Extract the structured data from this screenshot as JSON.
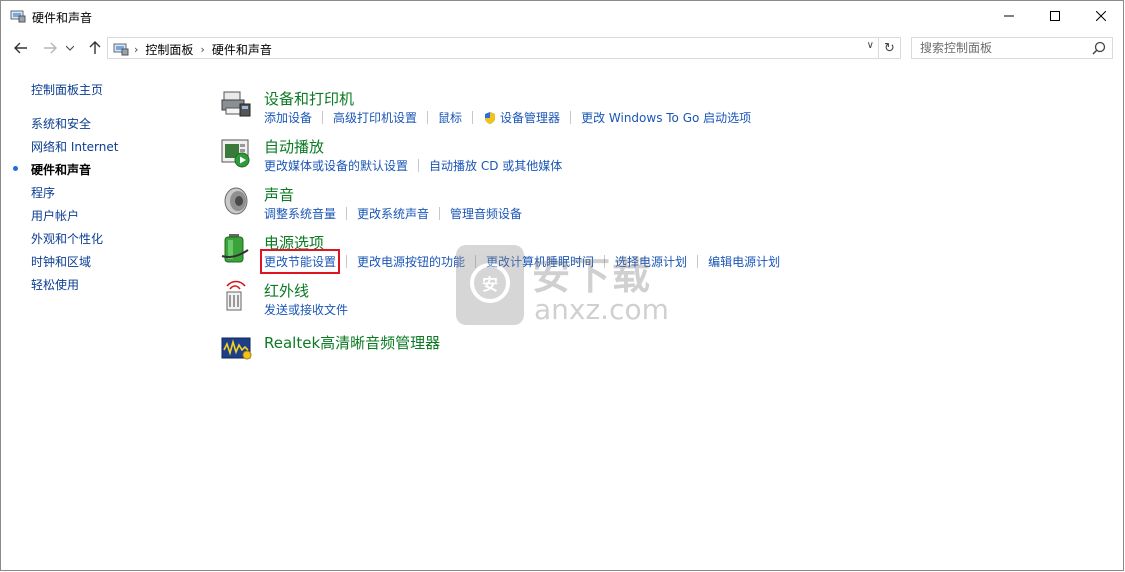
{
  "window": {
    "title": "硬件和声音"
  },
  "address": {
    "crumbs": [
      "控制面板",
      "硬件和声音"
    ]
  },
  "search": {
    "placeholder": "搜索控制面板"
  },
  "leftnav": {
    "home": "控制面板主页",
    "items": [
      {
        "label": "系统和安全",
        "active": false
      },
      {
        "label": "网络和 Internet",
        "active": false
      },
      {
        "label": "硬件和声音",
        "active": true
      },
      {
        "label": "程序",
        "active": false
      },
      {
        "label": "用户帐户",
        "active": false
      },
      {
        "label": "外观和个性化",
        "active": false
      },
      {
        "label": "时钟和区域",
        "active": false
      },
      {
        "label": "轻松使用",
        "active": false
      }
    ]
  },
  "categories": [
    {
      "title": "设备和打印机",
      "icon": "printer-icon",
      "links": [
        "添加设备",
        "高级打印机设置",
        "鼠标",
        "设备管理器",
        "更改 Windows To Go 启动选项"
      ]
    },
    {
      "title": "自动播放",
      "icon": "autoplay-icon",
      "links": [
        "更改媒体或设备的默认设置",
        "自动播放 CD 或其他媒体"
      ]
    },
    {
      "title": "声音",
      "icon": "speaker-icon",
      "links": [
        "调整系统音量",
        "更改系统声音",
        "管理音频设备"
      ]
    },
    {
      "title": "电源选项",
      "icon": "battery-icon",
      "links": [
        "更改节能设置",
        "更改电源按钮的功能",
        "更改计算机睡眠时间",
        "选择电源计划",
        "编辑电源计划"
      ]
    },
    {
      "title": "红外线",
      "icon": "infrared-icon",
      "links": [
        "发送或接收文件"
      ]
    },
    {
      "title": "Realtek高清晰音频管理器",
      "icon": "realtek-icon",
      "links": []
    }
  ],
  "watermark": {
    "text_cn": "安下载",
    "text_en": "anxz.com"
  },
  "colors": {
    "title_green": "#0b7a23",
    "link_blue": "#1a56b7",
    "highlight_red": "#e0141e"
  }
}
